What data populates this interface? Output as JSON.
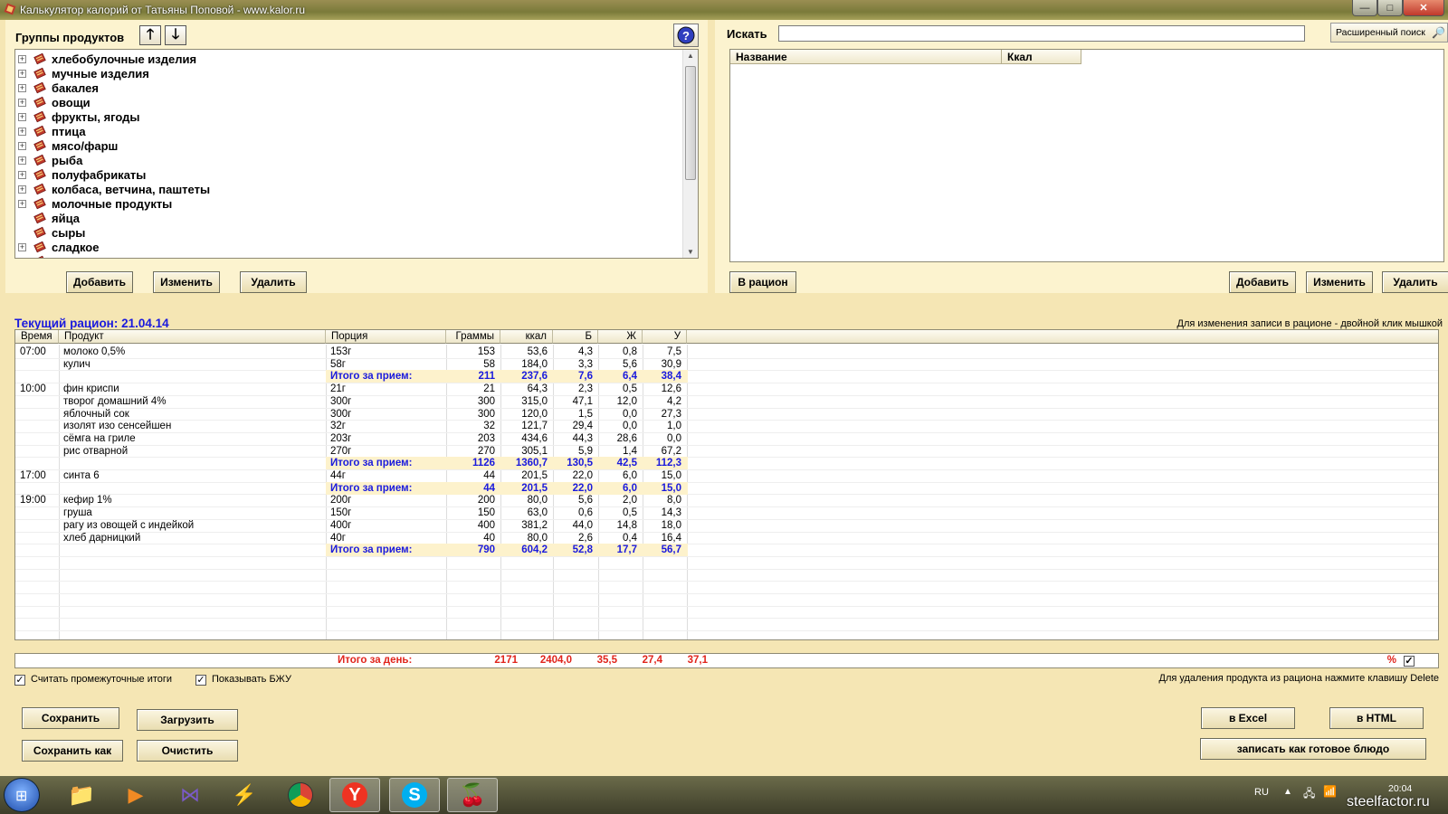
{
  "window": {
    "title": "Калькулятор калорий от Татьяны Поповой - www.kalor.ru",
    "minimize": "—",
    "maximize": "□",
    "close": "✕"
  },
  "groups": {
    "label": "Группы продуктов",
    "items": [
      {
        "label": "хлебобулочные изделия",
        "expandable": true
      },
      {
        "label": "мучные изделия",
        "expandable": true
      },
      {
        "label": "бакалея",
        "expandable": true
      },
      {
        "label": "овощи",
        "expandable": true
      },
      {
        "label": "фрукты, ягоды",
        "expandable": true
      },
      {
        "label": "птица",
        "expandable": true
      },
      {
        "label": "мясо/фарш",
        "expandable": true
      },
      {
        "label": "рыба",
        "expandable": true
      },
      {
        "label": "полуфабрикаты",
        "expandable": true
      },
      {
        "label": "колбаса, ветчина, паштеты",
        "expandable": true
      },
      {
        "label": "молочные продукты",
        "expandable": true
      },
      {
        "label": "яйца",
        "expandable": false
      },
      {
        "label": "сыры",
        "expandable": false
      },
      {
        "label": "сладкое",
        "expandable": true
      },
      {
        "label": "масла, жиры",
        "expandable": true
      }
    ],
    "add": "Добавить",
    "edit": "Изменить",
    "delete": "Удалить"
  },
  "search": {
    "label": "Искать",
    "value": "",
    "advanced": "Расширенный поиск",
    "col_name": "Название",
    "col_kcal": "Ккал",
    "to_diet": "В рацион",
    "add": "Добавить",
    "edit": "Изменить",
    "delete": "Удалить"
  },
  "diet": {
    "title": "Текущий рацион: 21.04.14",
    "hint": "Для изменения записи в рационе - двойной клик мышкой",
    "columns": [
      "Время",
      "Продукт",
      "Порция",
      "Граммы",
      "ккал",
      "Б",
      "Ж",
      "У"
    ],
    "rows": [
      {
        "time": "07:00",
        "product": "молоко 0,5%",
        "portion": "153г",
        "g": "153",
        "kcal": "53,6",
        "b": "4,3",
        "f": "0,8",
        "c": "7,5"
      },
      {
        "time": "",
        "product": "кулич",
        "portion": "58г",
        "g": "58",
        "kcal": "184,0",
        "b": "3,3",
        "f": "5,6",
        "c": "30,9"
      },
      {
        "total": true,
        "portion": "Итого за прием:",
        "g": "211",
        "kcal": "237,6",
        "b": "7,6",
        "f": "6,4",
        "c": "38,4"
      },
      {
        "time": "10:00",
        "product": "фин криспи",
        "portion": "21г",
        "g": "21",
        "kcal": "64,3",
        "b": "2,3",
        "f": "0,5",
        "c": "12,6"
      },
      {
        "time": "",
        "product": "творог домашний 4%",
        "portion": "300г",
        "g": "300",
        "kcal": "315,0",
        "b": "47,1",
        "f": "12,0",
        "c": "4,2"
      },
      {
        "time": "",
        "product": "яблочный сок",
        "portion": "300г",
        "g": "300",
        "kcal": "120,0",
        "b": "1,5",
        "f": "0,0",
        "c": "27,3"
      },
      {
        "time": "",
        "product": "изолят изо сенсейшен",
        "portion": "32г",
        "g": "32",
        "kcal": "121,7",
        "b": "29,4",
        "f": "0,0",
        "c": "1,0"
      },
      {
        "time": "",
        "product": "сёмга на гриле",
        "portion": "203г",
        "g": "203",
        "kcal": "434,6",
        "b": "44,3",
        "f": "28,6",
        "c": "0,0"
      },
      {
        "time": "",
        "product": "рис отварной",
        "portion": "270г",
        "g": "270",
        "kcal": "305,1",
        "b": "5,9",
        "f": "1,4",
        "c": "67,2"
      },
      {
        "total": true,
        "portion": "Итого за прием:",
        "g": "1126",
        "kcal": "1360,7",
        "b": "130,5",
        "f": "42,5",
        "c": "112,3"
      },
      {
        "time": "17:00",
        "product": "синта 6",
        "portion": "44г",
        "g": "44",
        "kcal": "201,5",
        "b": "22,0",
        "f": "6,0",
        "c": "15,0"
      },
      {
        "total": true,
        "portion": "Итого за прием:",
        "g": "44",
        "kcal": "201,5",
        "b": "22,0",
        "f": "6,0",
        "c": "15,0"
      },
      {
        "time": "19:00",
        "product": "кефир 1%",
        "portion": "200г",
        "g": "200",
        "kcal": "80,0",
        "b": "5,6",
        "f": "2,0",
        "c": "8,0"
      },
      {
        "time": "",
        "product": "груша",
        "portion": "150г",
        "g": "150",
        "kcal": "63,0",
        "b": "0,6",
        "f": "0,5",
        "c": "14,3"
      },
      {
        "time": "",
        "product": "рагу из овощей с индейкой",
        "portion": "400г",
        "g": "400",
        "kcal": "381,2",
        "b": "44,0",
        "f": "14,8",
        "c": "18,0"
      },
      {
        "time": "",
        "product": "хлеб дарницкий",
        "portion": "40г",
        "g": "40",
        "kcal": "80,0",
        "b": "2,6",
        "f": "0,4",
        "c": "16,4"
      },
      {
        "total": true,
        "portion": "Итого за прием:",
        "g": "790",
        "kcal": "604,2",
        "b": "52,8",
        "f": "17,7",
        "c": "56,7"
      }
    ],
    "day_total": {
      "label": "Итого за день:",
      "g": "2171",
      "kcal": "2404,0",
      "b": "35,5",
      "f": "27,4",
      "c": "37,1",
      "percent": "%"
    }
  },
  "options": {
    "intermediate": "Считать промежуточные итоги",
    "show_bju": "Показывать БЖУ",
    "delete_hint": "Для удаления продукта из рациона нажмите клавишу Delete"
  },
  "actions": {
    "save": "Сохранить",
    "load": "Загрузить",
    "save_as": "Сохранить как",
    "clear": "Очистить",
    "excel": "в Excel",
    "html": "в HTML",
    "save_dish": "записать как готовое блюдо"
  },
  "taskbar": {
    "lang": "RU",
    "time": "20:04",
    "watermark": "steelfactor.ru"
  }
}
